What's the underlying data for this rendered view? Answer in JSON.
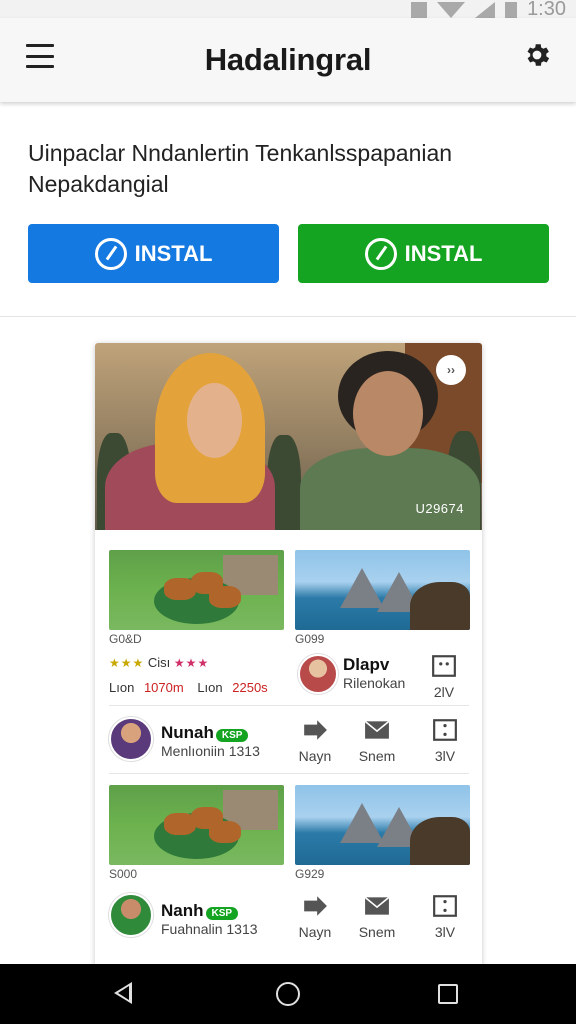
{
  "status_bar": {
    "time": "1:30"
  },
  "app_bar": {
    "title": "Hadalingral"
  },
  "description": "Uinpaclar Nndanlertin Tenkanlsspapanian Nepakdangial",
  "buttons": {
    "install_blue": {
      "label": "INSTAL",
      "color": "#1479e0"
    },
    "install_green": {
      "label": "INSTAL",
      "color": "#15a421"
    }
  },
  "card": {
    "hero_caption": "U29674",
    "close_label": "››",
    "block1": {
      "left_label": "G0&D",
      "right_label": "G099",
      "stats_left": {
        "l1": "Lıon",
        "v1": "1070m",
        "l2": "Lıon",
        "v2": "2250s",
        "mid": "Cisı"
      },
      "profile": {
        "name": "Dlapv",
        "sub": "Rilenokan",
        "count": "2lV"
      }
    },
    "row1": {
      "name": "Nunah",
      "badge": "KSP",
      "sub": "Menlıoniin",
      "num": "1313",
      "actions": [
        {
          "label": "Nayn"
        },
        {
          "label": "Snem"
        },
        {
          "label": "3lV"
        }
      ]
    },
    "block2": {
      "left_label": "S000",
      "right_label": "G929"
    },
    "row2": {
      "name": "Nanh",
      "badge": "KSP",
      "sub": "Fuahnalin",
      "num": "1313",
      "actions": [
        {
          "label": "Nayn"
        },
        {
          "label": "Snem"
        },
        {
          "label": "3lV"
        }
      ]
    }
  },
  "nav_bar": {
    "back": "back",
    "home": "home",
    "recent": "recent"
  }
}
